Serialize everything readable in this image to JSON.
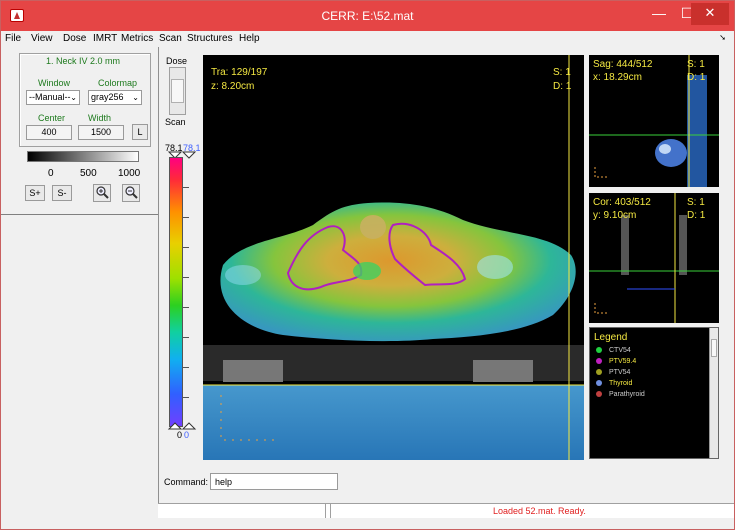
{
  "window": {
    "title": "CERR:  E:\\52.mat",
    "min_label": "—",
    "max_label": "☐",
    "close_label": "✕"
  },
  "menu": {
    "items": [
      "File",
      "View",
      "Dose",
      "IMRT",
      "Metrics",
      "Scan",
      "Structures",
      "Help"
    ]
  },
  "controls": {
    "scan_label": "1. Neck IV  2.0 mm",
    "window_label": "Window",
    "colormap_label": "Colormap",
    "window_value": "--Manual--",
    "colormap_value": "gray256",
    "center_label": "Center",
    "width_label": "Width",
    "center_value": "400",
    "width_value": "1500",
    "lock_label": "L",
    "gray_ticks": [
      "0",
      "500",
      "1000"
    ],
    "splus_label": "S+",
    "sminus_label": "S-"
  },
  "dose_controls": {
    "dose_label": "Dose",
    "scan_label": "Scan",
    "max_black": "78.1",
    "max_blue": "78.1",
    "min_black": "0",
    "min_blue": "0"
  },
  "main_view": {
    "slice": "Tra: 129/197",
    "z": "z: 8.20cm",
    "s_label": "S: 1",
    "d_label": "D: 1"
  },
  "sag_view": {
    "slice": "Sag: 444/512",
    "pos": "x: 18.29cm",
    "s_label": "S: 1",
    "d_label": "D: 1"
  },
  "cor_view": {
    "slice": "Cor: 403/512",
    "pos": "y: 9.10cm",
    "s_label": "S: 1",
    "d_label": "D: 1"
  },
  "legend": {
    "title": "Legend",
    "items": [
      {
        "name": "CTV54",
        "color": "#20d040"
      },
      {
        "name": "PTV59.4",
        "color": "#c020c0"
      },
      {
        "name": "PTV54",
        "color": "#a0a020"
      },
      {
        "name": "Thyroid",
        "color": "#7090e0"
      },
      {
        "name": "Parathyroid",
        "color": "#c04040"
      }
    ]
  },
  "command": {
    "label": "Command:",
    "value": "help"
  },
  "status": {
    "message": "Loaded 52.mat. Ready."
  },
  "colors": {
    "titlebar": "#e54545",
    "overlay_text": "#f4e842",
    "crosshair": "#f4e842",
    "status_text": "#e02020"
  }
}
